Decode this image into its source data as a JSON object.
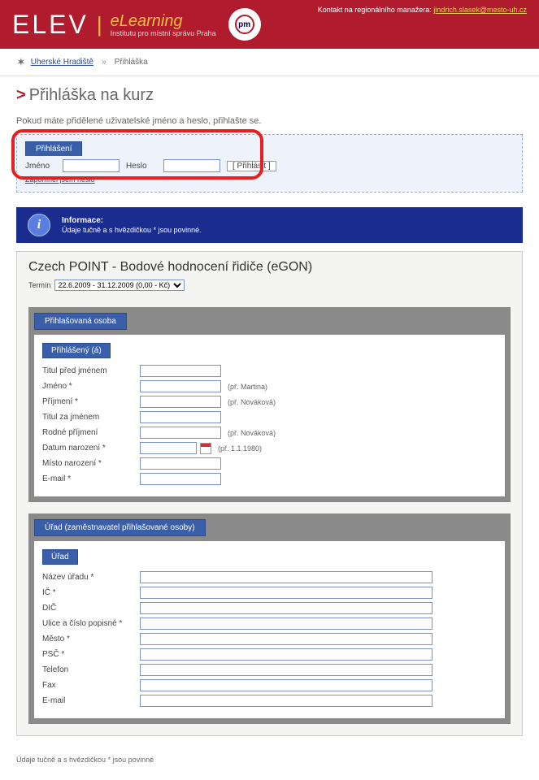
{
  "header": {
    "logo": "ELEV",
    "brand": "eLearning",
    "subtitle": "Institutu pro místní správu Praha",
    "badge": "pm",
    "contact_label": "Kontakt na regionálního manažera:",
    "contact_email": "jindrich.slasek@mesto-uh.cz"
  },
  "breadcrumb": {
    "link": "Uherské Hradiště",
    "current": "Přihláška"
  },
  "page": {
    "title": "Přihláška na kurz",
    "instruction": "Pokud máte přidělené uživatelské jméno a heslo, přihlašte se."
  },
  "login": {
    "tab": "Přihlášení",
    "username_label": "Jméno",
    "password_label": "Heslo",
    "button": "[ Přihlásit ]",
    "forgot": "Zapomněl jsem heslo"
  },
  "info": {
    "title": "Informace:",
    "text": "Údaje tučně a s hvězdičkou * jsou povinné."
  },
  "course": {
    "title": "Czech POINT - Bodové hodnocení řidiče (eGON)",
    "term_label": "Termín",
    "term_option": "22.6.2009 - 31.12.2009 (0,00 - Kč)"
  },
  "person_section": {
    "tab": "Přihlašovaná osoba",
    "subtab": "Přihlášený (á)",
    "fields": {
      "title_before": "Titul před jménem",
      "firstname": "Jméno *",
      "firstname_hint": "(př. Martina)",
      "surname": "Příjmení *",
      "surname_hint": "(př. Nováková)",
      "title_after": "Titul za jménem",
      "maiden": "Rodné příjmení",
      "maiden_hint": "(př. Nováková)",
      "birthdate": "Datum narození *",
      "birthdate_hint": "(př. 1.1.1980)",
      "birthplace": "Místo narození *",
      "email": "E-mail *"
    }
  },
  "office_section": {
    "tab": "Úřad (zaměstnavatel přihlašované osoby)",
    "subtab": "Úřad",
    "fields": {
      "name": "Název úřadu *",
      "ic": "IČ *",
      "dic": "DIČ",
      "street": "Ulice a číslo popisné *",
      "city": "Město *",
      "psc": "PSČ *",
      "phone": "Telefon",
      "fax": "Fax",
      "email": "E-mail"
    }
  },
  "footnote": "Údaje tučně a s hvězdičkou * jsou povinné"
}
